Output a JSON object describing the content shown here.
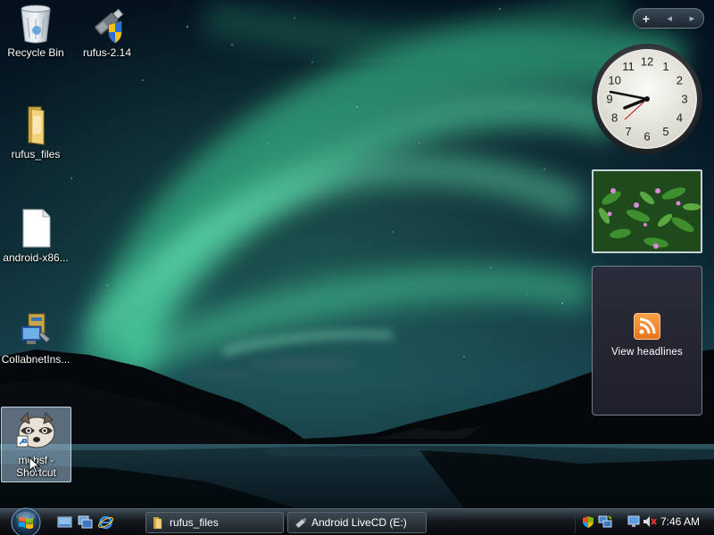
{
  "desktop": {
    "icons": [
      {
        "label": "Recycle Bin"
      },
      {
        "label": "rufus-2.14"
      },
      {
        "label": "rufus_files"
      },
      {
        "label": "android-x86..."
      },
      {
        "label": "CollabnetIns..."
      },
      {
        "label": "mobsf - Shortcut",
        "selected": true
      }
    ]
  },
  "sidebar": {
    "controls": {
      "add": "+",
      "prev": "◂",
      "next": "▸"
    },
    "clock": {
      "time": "8:46",
      "numerals": [
        "12",
        "1",
        "2",
        "3",
        "4",
        "5",
        "6",
        "7",
        "8",
        "9",
        "10",
        "11"
      ]
    },
    "feed": {
      "label": "View headlines"
    }
  },
  "taskbar": {
    "quick_launch": [
      "show-desktop-icon",
      "switch-windows-icon",
      "internet-explorer-icon"
    ],
    "buttons": [
      {
        "label": "rufus_files",
        "icon": "folder-icon"
      },
      {
        "label": "Android LiveCD (E:)",
        "icon": "drive-icon"
      }
    ],
    "tray": {
      "icons": [
        "security-center-icon",
        "network-icon",
        "volume-muted-icon"
      ],
      "time": "7:46 AM"
    }
  }
}
